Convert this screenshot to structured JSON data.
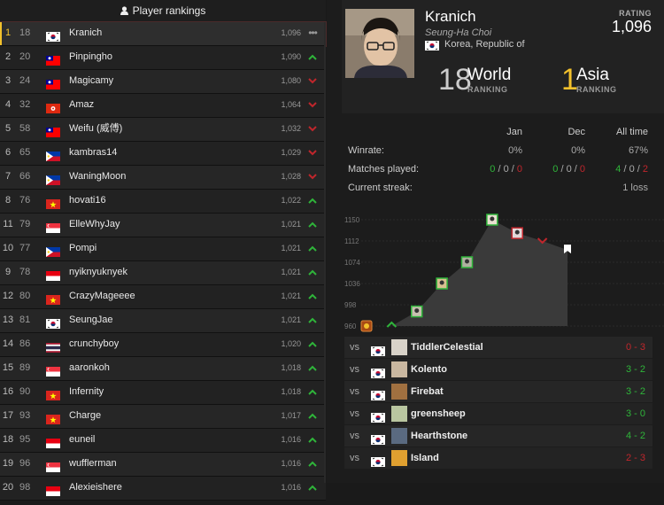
{
  "panel_title": "Player rankings",
  "colors": {
    "win": "#2fb43a",
    "loss": "#c0262c",
    "highlight": "#f3c12c"
  },
  "rankings": [
    {
      "rank": "1",
      "world": "18",
      "country": "kr",
      "name": "Kranich",
      "rating": "1,096",
      "trend": "flat"
    },
    {
      "rank": "2",
      "world": "20",
      "country": "tw",
      "name": "Pinpingho",
      "rating": "1,090",
      "trend": "up"
    },
    {
      "rank": "3",
      "world": "24",
      "country": "tw",
      "name": "Magicamy",
      "rating": "1,080",
      "trend": "down"
    },
    {
      "rank": "4",
      "world": "32",
      "country": "hk",
      "name": "Amaz",
      "rating": "1,064",
      "trend": "down"
    },
    {
      "rank": "5",
      "world": "58",
      "country": "tw",
      "name": "Weifu (威傅)",
      "rating": "1,032",
      "trend": "down"
    },
    {
      "rank": "6",
      "world": "65",
      "country": "ph",
      "name": "kambras14",
      "rating": "1,029",
      "trend": "down"
    },
    {
      "rank": "7",
      "world": "66",
      "country": "ph",
      "name": "WaningMoon",
      "rating": "1,028",
      "trend": "down"
    },
    {
      "rank": "8",
      "world": "76",
      "country": "vn",
      "name": "hovati16",
      "rating": "1,022",
      "trend": "up"
    },
    {
      "rank": "11",
      "world": "79",
      "country": "sg",
      "name": "ElleWhyJay",
      "rating": "1,021",
      "trend": "up"
    },
    {
      "rank": "10",
      "world": "77",
      "country": "ph",
      "name": "Pompi",
      "rating": "1,021",
      "trend": "up"
    },
    {
      "rank": "9",
      "world": "78",
      "country": "id",
      "name": "nyiknyuknyek",
      "rating": "1,021",
      "trend": "up"
    },
    {
      "rank": "12",
      "world": "80",
      "country": "vn",
      "name": "CrazyMageeee",
      "rating": "1,021",
      "trend": "up"
    },
    {
      "rank": "13",
      "world": "81",
      "country": "kr",
      "name": "SeungJae",
      "rating": "1,021",
      "trend": "up"
    },
    {
      "rank": "14",
      "world": "86",
      "country": "th",
      "name": "crunchyboy",
      "rating": "1,020",
      "trend": "up"
    },
    {
      "rank": "15",
      "world": "89",
      "country": "sg",
      "name": "aaronkoh",
      "rating": "1,018",
      "trend": "up"
    },
    {
      "rank": "16",
      "world": "90",
      "country": "vn",
      "name": "Infernity",
      "rating": "1,018",
      "trend": "up"
    },
    {
      "rank": "17",
      "world": "93",
      "country": "vn",
      "name": "Charge",
      "rating": "1,017",
      "trend": "up"
    },
    {
      "rank": "18",
      "world": "95",
      "country": "id",
      "name": "euneil",
      "rating": "1,016",
      "trend": "up"
    },
    {
      "rank": "19",
      "world": "96",
      "country": "sg",
      "name": "wufflerman",
      "rating": "1,016",
      "trend": "up"
    },
    {
      "rank": "20",
      "world": "98",
      "country": "id",
      "name": "Alexieishere",
      "rating": "1,016",
      "trend": "up"
    }
  ],
  "profile": {
    "name": "Kranich",
    "real_name": "Seung-Ha Choi",
    "country": "Korea, Republic of",
    "rating_label": "RATING",
    "rating": "1,096",
    "world_rank": "18",
    "world_label": "World",
    "world_sub": "RANKING",
    "asia_rank": "1",
    "asia_label": "Asia",
    "asia_sub": "RANKING"
  },
  "stats": {
    "columns": [
      "Jan",
      "Dec",
      "All time"
    ],
    "winrate_label": "Winrate:",
    "winrate": [
      "0%",
      "0%",
      "67%"
    ],
    "matches_label": "Matches played:",
    "matches": [
      [
        "0",
        "0",
        "0"
      ],
      [
        "0",
        "0",
        "0"
      ],
      [
        "4",
        "0",
        "2"
      ]
    ],
    "streak_label": "Current streak:",
    "streak": "1 loss"
  },
  "chart_data": {
    "type": "line",
    "y_ticks": [
      "1150",
      "1112",
      "1074",
      "1036",
      "998",
      "960"
    ],
    "ylim": [
      960,
      1150
    ],
    "points": [
      {
        "y": 960,
        "marker": "hs-icon"
      },
      {
        "y": 960,
        "marker": "win-arrow"
      },
      {
        "y": 986,
        "marker": "avatar"
      },
      {
        "y": 1036,
        "marker": "avatar"
      },
      {
        "y": 1074,
        "marker": "avatar"
      },
      {
        "y": 1150,
        "marker": "avatar"
      },
      {
        "y": 1126,
        "marker": "avatar"
      },
      {
        "y": 1112,
        "marker": "loss-arrow"
      },
      {
        "y": 1096,
        "marker": "current-flag"
      }
    ]
  },
  "matches": [
    {
      "vs": "vs",
      "country": "kr",
      "opponent": "TiddlerCelestial",
      "score": "0 - 3",
      "result": "loss"
    },
    {
      "vs": "vs",
      "country": "kr",
      "opponent": "Kolento",
      "score": "3 - 2",
      "result": "win"
    },
    {
      "vs": "vs",
      "country": "kr",
      "opponent": "Firebat",
      "score": "3 - 2",
      "result": "win"
    },
    {
      "vs": "vs",
      "country": "kr",
      "opponent": "greensheep",
      "score": "3 - 0",
      "result": "win"
    },
    {
      "vs": "vs",
      "country": "kr",
      "opponent": "Hearthstone",
      "score": "4 - 2",
      "result": "win"
    },
    {
      "vs": "vs",
      "country": "kr",
      "opponent": "Island",
      "score": "2 - 3",
      "result": "loss"
    }
  ]
}
